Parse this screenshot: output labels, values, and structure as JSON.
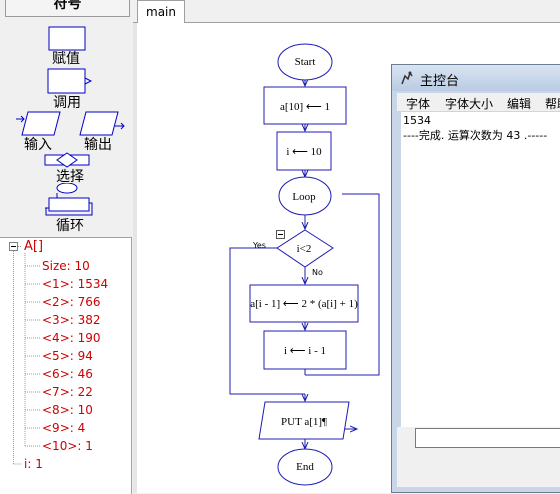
{
  "palette": {
    "header": "符号",
    "symbols": {
      "assign": "赋值",
      "call": "调用",
      "input": "输入",
      "output": "输出",
      "select": "选择",
      "loop": "循环"
    }
  },
  "tree": {
    "root": "A[]",
    "items": [
      "Size: 10",
      "<1>: 1534",
      "<2>: 766",
      "<3>: 382",
      "<4>: 190",
      "<5>: 94",
      "<6>: 46",
      "<7>: 22",
      "<8>: 10",
      "<9>: 4",
      "<10>: 1"
    ],
    "var_i": "i: 1",
    "toggle": "−"
  },
  "tabs": {
    "main": "main"
  },
  "flowchart": {
    "start": "Start",
    "assign1": "a[10] ⟵ 1",
    "assign2": "i ⟵ 10",
    "loop": "Loop",
    "cond": "i<2",
    "yes": "Yes",
    "no": "No",
    "assign3": "a[i - 1] ⟵ 2 * (a[i] + 1)",
    "assign4": "i ⟵ i - 1",
    "output": "PUT a[1]¶",
    "end": "End",
    "collapse": "−"
  },
  "console": {
    "title": "主控台",
    "menu": [
      "字体",
      "字体大小",
      "编辑",
      "帮助"
    ],
    "output_lines": [
      "1534",
      "----完成. 运算次数为  43 .-----"
    ]
  },
  "colors": {
    "shape_stroke": "#1c1cb4",
    "tree_text": "#d00000",
    "palette_stroke": "#0000c8"
  }
}
